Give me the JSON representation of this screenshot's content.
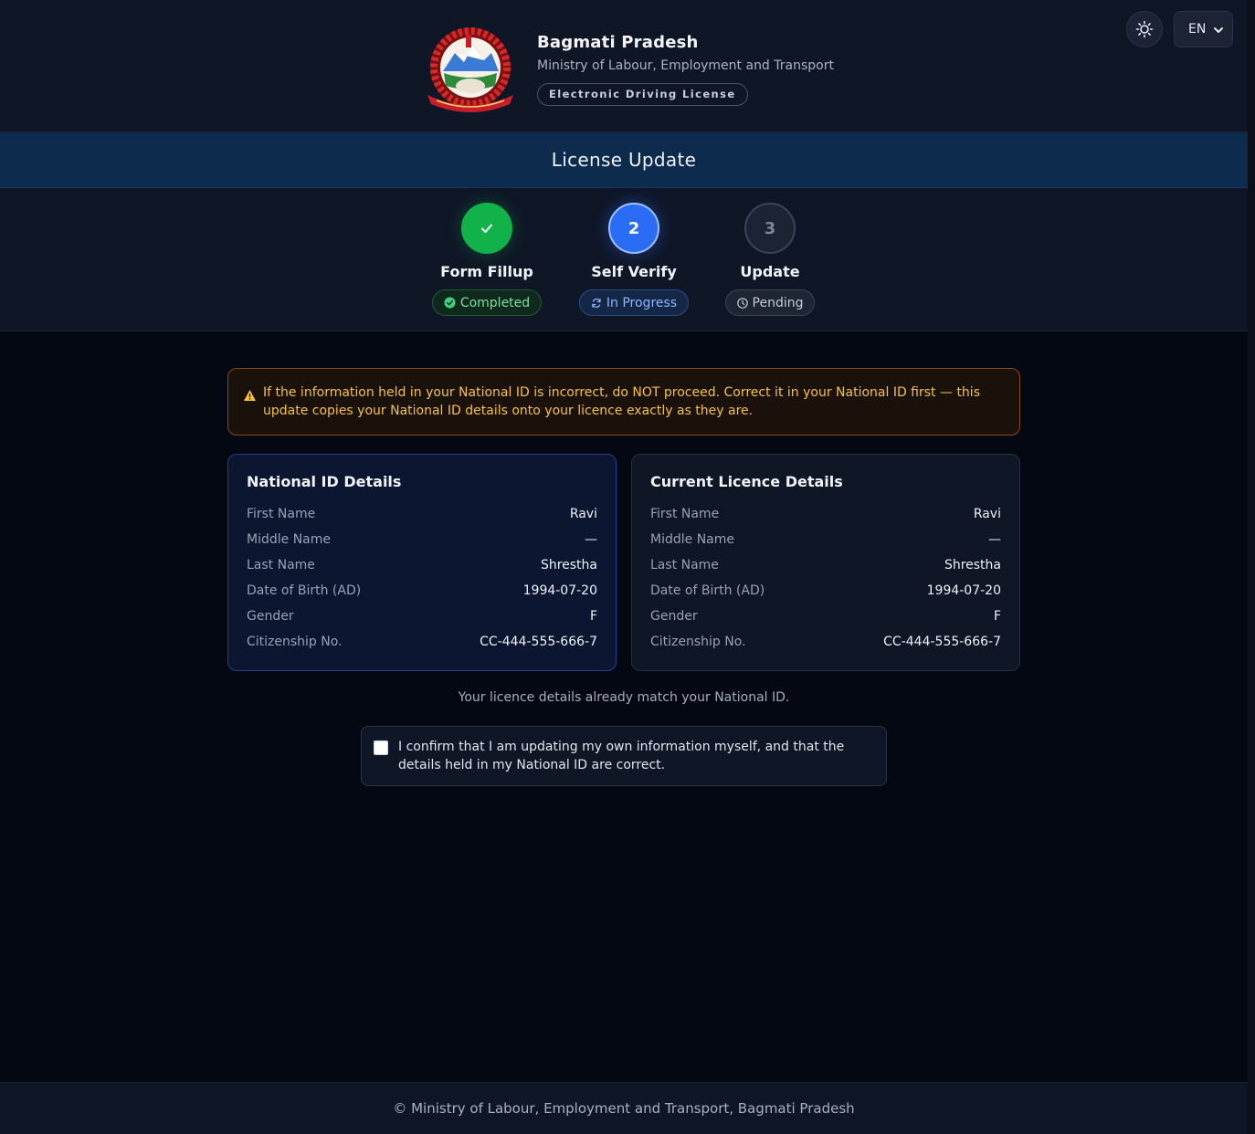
{
  "header": {
    "title": "Bagmati Pradesh",
    "subtitle": "Ministry of Labour, Employment and Transport",
    "pill": "Electronic Driving License",
    "theme_icon": "sun-icon",
    "language": "EN"
  },
  "page_title": "License Update",
  "steps": [
    {
      "number": "✓",
      "label": "Form Fillup",
      "status": "Completed",
      "state": "done"
    },
    {
      "number": "2",
      "label": "Self Verify",
      "status": "In Progress",
      "state": "active"
    },
    {
      "number": "3",
      "label": "Update",
      "status": "Pending",
      "state": "pending"
    }
  ],
  "warning": {
    "text": "If the information held in your National ID is incorrect, do NOT proceed. Correct it in your National ID first — this update copies your National ID details onto your licence exactly as they are."
  },
  "national_id": {
    "title": "National ID Details",
    "rows": [
      {
        "label": "First Name",
        "value": "Ravi"
      },
      {
        "label": "Middle Name",
        "value": "—"
      },
      {
        "label": "Last Name",
        "value": "Shrestha"
      },
      {
        "label": "Date of Birth (AD)",
        "value": "1994-07-20"
      },
      {
        "label": "Gender",
        "value": "F"
      },
      {
        "label": "Citizenship No.",
        "value": "CC-444-555-666-7"
      }
    ]
  },
  "current_licence": {
    "title": "Current Licence Details",
    "rows": [
      {
        "label": "First Name",
        "value": "Ravi"
      },
      {
        "label": "Middle Name",
        "value": "—"
      },
      {
        "label": "Last Name",
        "value": "Shrestha"
      },
      {
        "label": "Date of Birth (AD)",
        "value": "1994-07-20"
      },
      {
        "label": "Gender",
        "value": "F"
      },
      {
        "label": "Citizenship No.",
        "value": "CC-444-555-666-7"
      }
    ]
  },
  "match_note": "Your licence details already match your National ID.",
  "confirm": {
    "checked": false,
    "text": "I confirm that I am updating my own information myself, and that the details held in my National ID are correct."
  },
  "footer": "© Ministry of Labour, Employment and Transport, Bagmati Pradesh",
  "colors": {
    "accent": "#2a6df4",
    "success": "#12b24a",
    "warning": "#f5c244",
    "background": "#040813"
  }
}
